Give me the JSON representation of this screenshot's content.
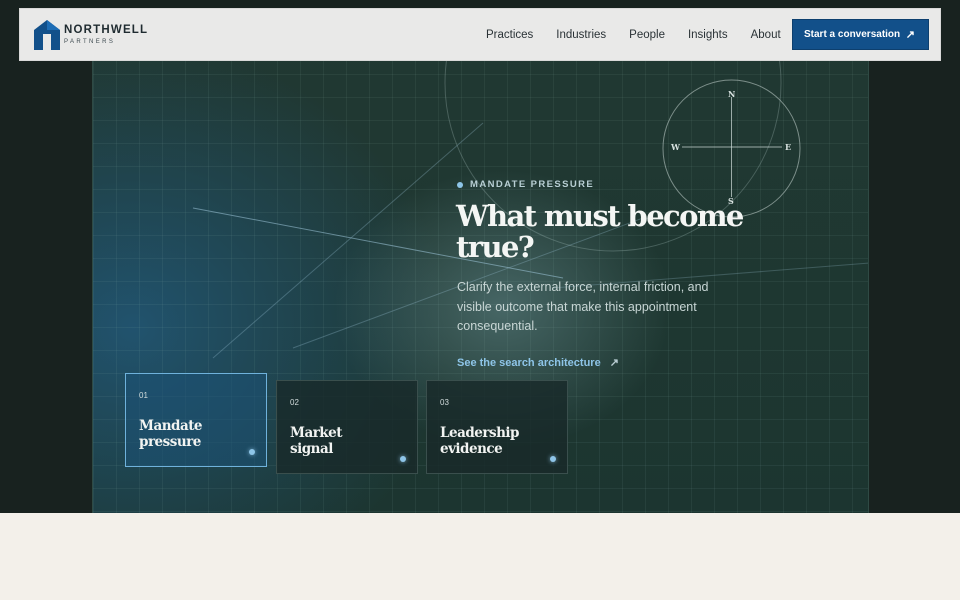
{
  "brand": {
    "name": "NORTHWELL",
    "sub": "PARTNERS",
    "color": "#12508a"
  },
  "nav": {
    "items": [
      "Practices",
      "Industries",
      "People",
      "Insights",
      "About"
    ],
    "cta_label": "Start a conversation",
    "cta_icon": "arrow-up-right-icon"
  },
  "hero": {
    "eyebrow": "MANDATE PRESSURE",
    "headline_line1": "What must become",
    "headline_line2": "true?",
    "body": "Clarify the external force, internal friction, and visible outcome that make this appointment consequential.",
    "link_label": "See the search architecture",
    "link_icon": "arrow-up-right-icon"
  },
  "compass": {
    "n": "N",
    "s": "S",
    "e": "E",
    "w": "W"
  },
  "cards": [
    {
      "num": "01",
      "title_line1": "Mandate",
      "title_line2": "pressure",
      "active": true
    },
    {
      "num": "02",
      "title_line1": "Market",
      "title_line2": "signal",
      "active": false
    },
    {
      "num": "03",
      "title_line1": "Leadership",
      "title_line2": "evidence",
      "active": false
    }
  ],
  "colors": {
    "dark_bg": "#18221f",
    "accent": "#8ec5e8",
    "cream": "#f3f0ea"
  }
}
